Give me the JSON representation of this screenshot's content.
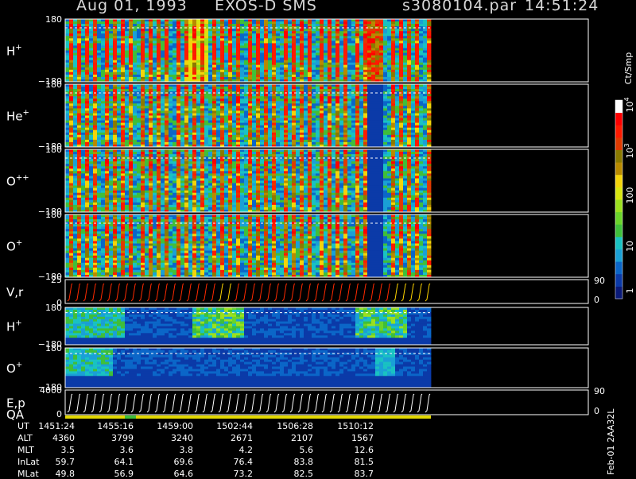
{
  "header": {
    "date": "Aug 01, 1993",
    "instrument": "EXOS-D SMS",
    "file": "s3080104.par",
    "time": "14:51:24"
  },
  "colorbar": {
    "unit": "Ct/Smp",
    "ticks": [
      "1",
      "10",
      "100",
      "10",
      "10"
    ],
    "tick_exponents": [
      "",
      "",
      "",
      "3",
      "4"
    ],
    "colors": [
      "#0a1a78",
      "#0b3aa8",
      "#0b66c8",
      "#1aa0d6",
      "#19c2c2",
      "#3fbf3a",
      "#6ad42a",
      "#9be01e",
      "#d8e60f",
      "#f3d40a",
      "#b88a00",
      "#8a7a00",
      "#e03a00",
      "#ff1a00",
      "#ff0000",
      "#ffffff"
    ]
  },
  "panels": [
    {
      "id": "H+",
      "label": "H",
      "label_sup": "+",
      "y_top": "180",
      "y_bottom": "−180",
      "right_top": "",
      "right_bottom": ""
    },
    {
      "id": "He+",
      "label": "He",
      "label_sup": "+",
      "y_top": "180",
      "y_bottom": "−180",
      "right_top": "",
      "right_bottom": ""
    },
    {
      "id": "O++",
      "label": "O",
      "label_sup": "++",
      "y_top": "180",
      "y_bottom": "−180",
      "right_top": "",
      "right_bottom": ""
    },
    {
      "id": "O+",
      "label": "O",
      "label_sup": "+",
      "y_top": "180",
      "y_bottom": "−180",
      "right_top": "",
      "right_bottom": ""
    },
    {
      "id": "Vr",
      "label": "V,r",
      "label_sup": "",
      "y_top": "25",
      "y_bottom": "0",
      "right_top": "90",
      "right_bottom": "0"
    },
    {
      "id": "H+2",
      "label": "H",
      "label_sup": "+",
      "y_top": "180",
      "y_bottom": "−180",
      "right_top": "",
      "right_bottom": ""
    },
    {
      "id": "O+2",
      "label": "O",
      "label_sup": "+",
      "y_top": "180",
      "y_bottom": "−180",
      "right_top": "",
      "right_bottom": ""
    },
    {
      "id": "Ep",
      "label": "E,p",
      "label_sup": "",
      "label2": "QA",
      "y_top": "4000",
      "y_bottom": "0",
      "right_top": "90",
      "right_bottom": "0"
    }
  ],
  "chart_data": {
    "type": "heatmap",
    "x_axis": "UT",
    "x_ticks": [
      "1451:24",
      "1455:16",
      "1459:00",
      "1502:44",
      "1506:28",
      "1510:12"
    ],
    "x_range": [
      "1451:24",
      "1513:00"
    ],
    "y_range": [
      -180,
      180
    ],
    "colorbar_label": "Ct/Smp",
    "colorbar_range": [
      1,
      10000
    ],
    "colorbar_scale": "log",
    "series": [
      {
        "name": "H+"
      },
      {
        "name": "He+"
      },
      {
        "name": "O++"
      },
      {
        "name": "O+"
      },
      {
        "name": "V,r",
        "y_range": [
          0,
          25
        ],
        "right_range": [
          0,
          90
        ]
      },
      {
        "name": "H+",
        "y_range": [
          -180,
          180
        ]
      },
      {
        "name": "O+",
        "y_range": [
          -180,
          180
        ]
      },
      {
        "name": "E,p",
        "y_range": [
          0,
          4000
        ],
        "right_range": [
          0,
          90
        ]
      }
    ]
  },
  "orbit": {
    "labels": [
      "UT",
      "ALT",
      "MLT",
      "InLat",
      "MLat"
    ],
    "rows": [
      [
        "1451:24",
        "1455:16",
        "1459:00",
        "1502:44",
        "1506:28",
        "1510:12"
      ],
      [
        "4360",
        "3799",
        "3240",
        "2671",
        "2107",
        "1567"
      ],
      [
        "3.5",
        "3.6",
        "3.8",
        "4.2",
        "5.6",
        "12.6"
      ],
      [
        "59.7",
        "64.1",
        "69.6",
        "76.4",
        "83.8",
        "81.5"
      ],
      [
        "49.8",
        "56.9",
        "64.6",
        "73.2",
        "82.5",
        "83.7"
      ]
    ]
  },
  "footer": {
    "stamp": "Feb-01 2AA32L"
  }
}
